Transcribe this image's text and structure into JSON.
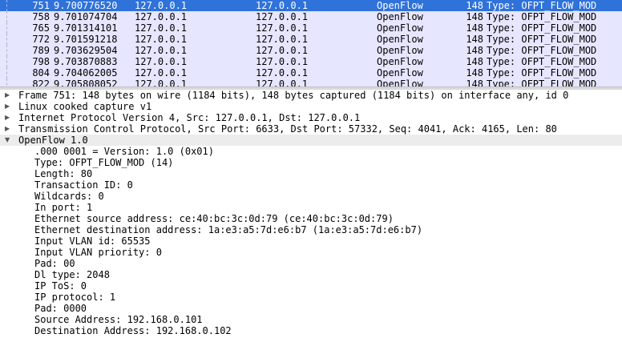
{
  "packet_list": {
    "rows": [
      {
        "no": "751",
        "time": "9.700776520",
        "src": "127.0.0.1",
        "dst": "127.0.0.1",
        "proto": "OpenFlow",
        "len": "148",
        "info": "Type: OFPT_FLOW_MOD",
        "selected": true
      },
      {
        "no": "758",
        "time": "9.701074704",
        "src": "127.0.0.1",
        "dst": "127.0.0.1",
        "proto": "OpenFlow",
        "len": "148",
        "info": "Type: OFPT_FLOW_MOD",
        "selected": false
      },
      {
        "no": "765",
        "time": "9.701314101",
        "src": "127.0.0.1",
        "dst": "127.0.0.1",
        "proto": "OpenFlow",
        "len": "148",
        "info": "Type: OFPT_FLOW_MOD",
        "selected": false
      },
      {
        "no": "772",
        "time": "9.701591218",
        "src": "127.0.0.1",
        "dst": "127.0.0.1",
        "proto": "OpenFlow",
        "len": "148",
        "info": "Type: OFPT_FLOW_MOD",
        "selected": false
      },
      {
        "no": "789",
        "time": "9.703629504",
        "src": "127.0.0.1",
        "dst": "127.0.0.1",
        "proto": "OpenFlow",
        "len": "148",
        "info": "Type: OFPT_FLOW_MOD",
        "selected": false
      },
      {
        "no": "798",
        "time": "9.703870883",
        "src": "127.0.0.1",
        "dst": "127.0.0.1",
        "proto": "OpenFlow",
        "len": "148",
        "info": "Type: OFPT_FLOW_MOD",
        "selected": false
      },
      {
        "no": "804",
        "time": "9.704062005",
        "src": "127.0.0.1",
        "dst": "127.0.0.1",
        "proto": "OpenFlow",
        "len": "148",
        "info": "Type: OFPT_FLOW_MOD",
        "selected": false
      },
      {
        "no": "822",
        "time": "9.705808052",
        "src": "127.0.0.1",
        "dst": "127.0.0.1",
        "proto": "OpenFlow",
        "len": "148",
        "info": "Type: OFPT_FLOW_MOD",
        "selected": false
      }
    ]
  },
  "details": {
    "collapsed_icon": "triangle-right-icon",
    "expanded_icon": "triangle-down-icon",
    "sections": [
      {
        "text": "Frame 751: 148 bytes on wire (1184 bits), 148 bytes captured (1184 bits) on interface any, id 0",
        "expanded": false
      },
      {
        "text": "Linux cooked capture v1",
        "expanded": false
      },
      {
        "text": "Internet Protocol Version 4, Src: 127.0.0.1, Dst: 127.0.0.1",
        "expanded": false
      },
      {
        "text": "Transmission Control Protocol, Src Port: 6633, Dst Port: 57332, Seq: 4041, Ack: 4165, Len: 80",
        "expanded": false
      },
      {
        "text": "OpenFlow 1.0",
        "expanded": true,
        "children": [
          ".000 0001 = Version: 1.0 (0x01)",
          "Type: OFPT_FLOW_MOD (14)",
          "Length: 80",
          "Transaction ID: 0",
          "Wildcards: 0",
          "In port: 1",
          "Ethernet source address: ce:40:bc:3c:0d:79 (ce:40:bc:3c:0d:79)",
          "Ethernet destination address: 1a:e3:a5:7d:e6:b7 (1a:e3:a5:7d:e6:b7)",
          "Input VLAN id: 65535",
          "Input VLAN priority: 0",
          "Pad: 00",
          "Dl type: 2048",
          "IP ToS: 0",
          "IP protocol: 1",
          "Pad: 0000",
          "Source Address: 192.168.0.101",
          "Destination Address: 192.168.0.102"
        ]
      }
    ]
  }
}
